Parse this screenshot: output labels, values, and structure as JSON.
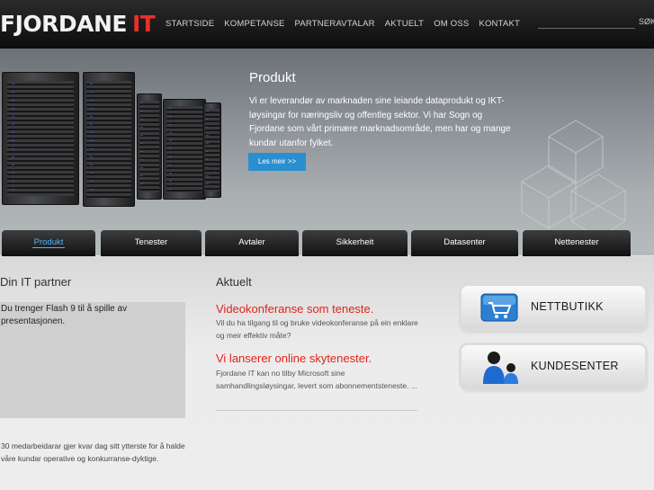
{
  "header": {
    "logo_main": "FJORDANE",
    "logo_accent": "IT",
    "nav": [
      "STARTSIDE",
      "KOMPETANSE",
      "PARTNERAVTALAR",
      "AKTUELT",
      "OM OSS",
      "KONTAKT"
    ],
    "search_label": "SØK"
  },
  "hero": {
    "title": "Produkt",
    "text": "Vi er leverandør av marknaden sine leiande dataprodukt og IKT-løysingar for næringsliv og offentleg sektor. Vi har Sogn og Fjordane som vårt primære marknadsområde, men har og mange kundar utanfor fylket.",
    "button": "Les meir >>"
  },
  "tabs": [
    {
      "label": "Produkt",
      "active": true
    },
    {
      "label": "Tenester",
      "active": false
    },
    {
      "label": "Avtaler",
      "active": false
    },
    {
      "label": "Sikkerheit",
      "active": false
    },
    {
      "label": "Datasenter",
      "active": false
    },
    {
      "label": "Nettenester",
      "active": false
    }
  ],
  "partner": {
    "title": "Din IT partner",
    "flash_notice": "Du trenger Flash 9 til å spille av presentasjonen.",
    "text": "30 medarbeidarar gjer kvar dag sitt ytterste for å halde våre kundar operative og konkurranse-dyktige."
  },
  "news": {
    "title": "Aktuelt",
    "items": [
      {
        "heading": "Videokonferanse som teneste.",
        "body": "Vil du ha tilgang til og bruke videokonferanse på ein enklare og meir effektiv måte?"
      },
      {
        "heading": "Vi lanserer online skytenester.",
        "body": "Fjordane IT kan no tilby Microsoft sine samhandlingsløysingar, levert som abonnementsteneste. ..."
      }
    ]
  },
  "side_links": [
    {
      "label": "NETTBUTIKK",
      "icon": "shopping-cart-icon"
    },
    {
      "label": "KUNDESENTER",
      "icon": "users-icon"
    }
  ],
  "colors": {
    "accent_red": "#e2231a",
    "accent_blue": "#2a8fd0",
    "active_tab": "#4fb4ff"
  }
}
